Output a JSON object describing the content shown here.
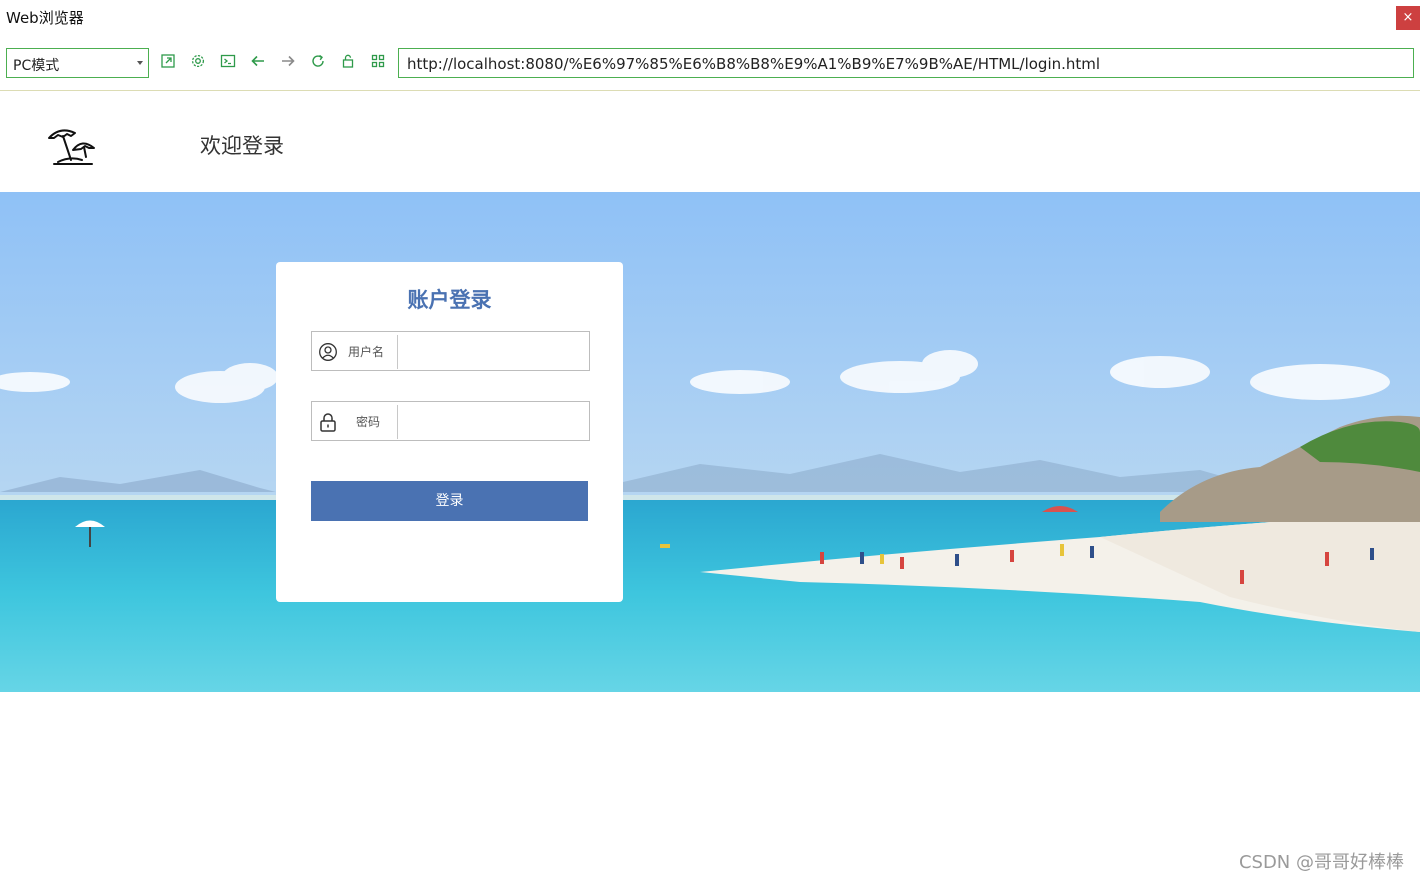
{
  "window": {
    "title": "Web浏览器",
    "close_glyph": "×"
  },
  "toolbar": {
    "mode_select": "PC模式",
    "icons": [
      "open-external-icon",
      "settings-gear-icon",
      "console-icon",
      "back-arrow-icon",
      "forward-arrow-icon",
      "refresh-icon",
      "lock-icon",
      "qr-grid-icon"
    ],
    "url": "http://localhost:8080/%E6%97%85%E6%B8%B8%E9%A1%B9%E7%9B%AE/HTML/login.html",
    "accent_color": "#4caf50"
  },
  "header": {
    "logo_icon": "beach-umbrella-icon",
    "welcome_text": "欢迎登录"
  },
  "login": {
    "title": "账户登录",
    "username_label": "用户名",
    "username_value": "",
    "username_icon": "user-circle-icon",
    "password_label": "密码",
    "password_value": "",
    "password_icon": "padlock-icon",
    "submit_label": "登录",
    "brand_color": "#4a72b2"
  },
  "watermark": "CSDN @哥哥好棒棒"
}
